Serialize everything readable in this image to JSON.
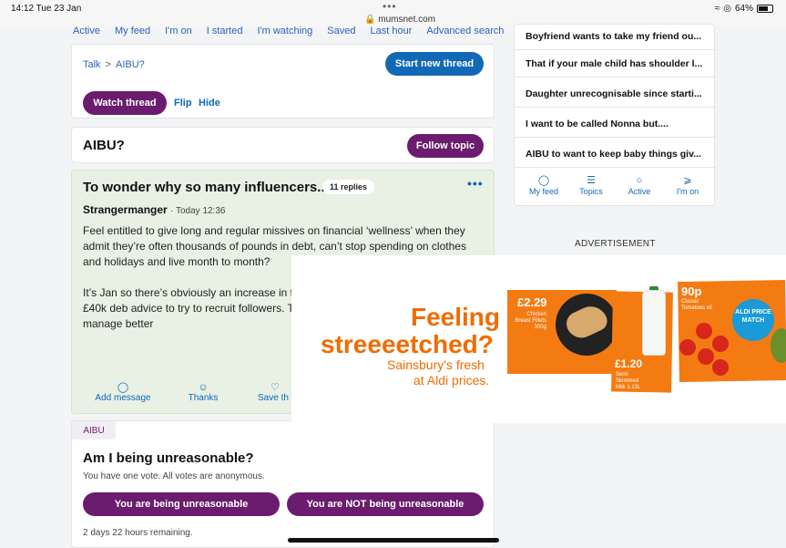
{
  "status": {
    "time": "14:12  Tue 23 Jan",
    "dots": "•••",
    "url": "mumsnet.com",
    "battery": "64%"
  },
  "top_tabs": [
    "Active",
    "My feed",
    "I'm on",
    "I started",
    "I'm watching",
    "Saved",
    "Last hour",
    "Advanced search"
  ],
  "talk": {
    "breadcrumb_talk": "Talk",
    "breadcrumb_sep": ">",
    "breadcrumb_topic": "AIBU?",
    "new_thread": "Start new thread",
    "watch": "Watch thread",
    "flip": "Flip",
    "hide": "Hide"
  },
  "topic": {
    "title": "AIBU?",
    "follow": "Follow topic"
  },
  "post": {
    "title": "To wonder why so many influencers...",
    "replies": "11 replies",
    "more": "•••",
    "author": "Strangermanger",
    "date": "· Today 12:36",
    "para1": "Feel entitled to give long and regular missives on financial ‘wellness’ when they admit they’re often thousands of pounds in debt, can’t stop spending on clothes and holidays and live month to month?",
    "para2": "It’s Jan so there’s obviously an increase in t someone that’s got themselves in £40k deb advice to try to recruit followers. These are away from if you’re trying to manage better",
    "actions": {
      "add": "Add message",
      "thanks": "Thanks",
      "save": "Save th"
    }
  },
  "poll": {
    "tag": "AIBU",
    "title": "Am I being unreasonable?",
    "subtitle": "You have one vote. All votes are anonymous.",
    "vote_yes": "You are being unreasonable",
    "vote_no": "You are NOT being unreasonable",
    "remaining": "2 days 22 hours remaining."
  },
  "sidebar": {
    "items": [
      "Boyfriend wants to take my friend ou...",
      "That if your male child has shoulder l...",
      "Daughter unrecognisable since starti...",
      "I want to be called Nonna but....",
      "AIBU to want to keep baby things giv..."
    ],
    "nav": [
      "My feed",
      "Topics",
      "Active",
      "I'm on"
    ]
  },
  "ad": {
    "label": "ADVERTISEMENT",
    "headline1": "Feeling",
    "headline2": "streeeetched?",
    "sub1": "Sainsbury's fresh",
    "sub2": "at Aldi prices.",
    "price1": "£2.29",
    "item1": "Chicken Breast Fillets 300g",
    "price2": "£1.20",
    "item2": "Semi Skimmed Milk 1.13L",
    "price3": "90p",
    "item3": "Classic Tomatoes x6",
    "badge": "ALDI PRICE MATCH"
  },
  "colors": {
    "purple": "#6b1c6e",
    "blue": "#1169b6",
    "post_bg": "#e8f1e4",
    "sainsbury_orange": "#f06c00"
  }
}
